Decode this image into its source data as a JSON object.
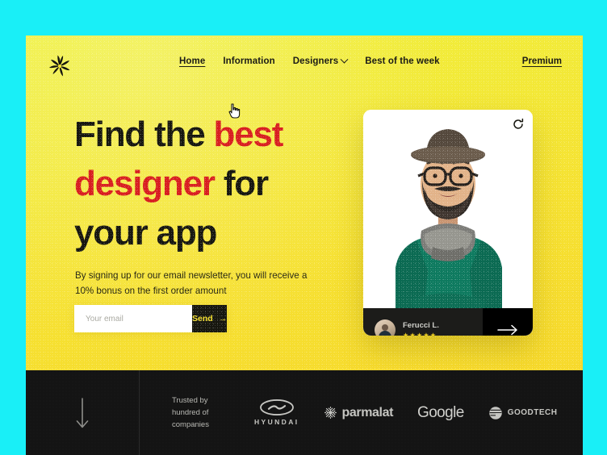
{
  "canvas": {
    "background_color": "#19EFF7"
  },
  "nav": {
    "logo_icon": "sunburst-swirl-logo",
    "links": [
      {
        "label": "Home",
        "active": true
      },
      {
        "label": "Information",
        "active": false
      },
      {
        "label": "Designers",
        "active": false,
        "has_dropdown": true
      },
      {
        "label": "Best of the week",
        "active": false
      }
    ],
    "premium_label": "Premium",
    "cursor_icon": "pointing-hand-cursor"
  },
  "hero": {
    "headline": {
      "line1_a": "Find the ",
      "line1_b": "best",
      "line2_a": "designer",
      "line2_b": " for",
      "line3": "your app"
    },
    "subtitle": "By signing up for our email newsletter, you will receive a 10% bonus on the first order amount",
    "form": {
      "email_placeholder": "Your email",
      "email_value": "",
      "send_label": "Send",
      "send_arrow": "→"
    },
    "colors": {
      "accent_red": "#D81E20",
      "yellow_top": "#EFF03C",
      "yellow_bottom": "#F7D92B",
      "dark": "#17170F"
    }
  },
  "card": {
    "refresh_icon": "refresh-icon",
    "designer_name": "Ferucci L.",
    "rating_stars": "★★★★★",
    "rating_value": 5,
    "arrow_label": "→"
  },
  "footer": {
    "scroll_icon": "arrow-down-icon",
    "trusted_text": "Trusted by hundred of companies",
    "brands": [
      {
        "name": "Hyundai",
        "label": "HYUNDAI",
        "icon": "hyundai-oval-h-logo"
      },
      {
        "name": "Parmalat",
        "label": "parmalat",
        "icon": "parmalat-snowflake-logo"
      },
      {
        "name": "Google",
        "label": "Google",
        "icon": ""
      },
      {
        "name": "Goodtech",
        "label": "GOODTECH",
        "icon": "goodtech-globe-logo"
      }
    ]
  }
}
